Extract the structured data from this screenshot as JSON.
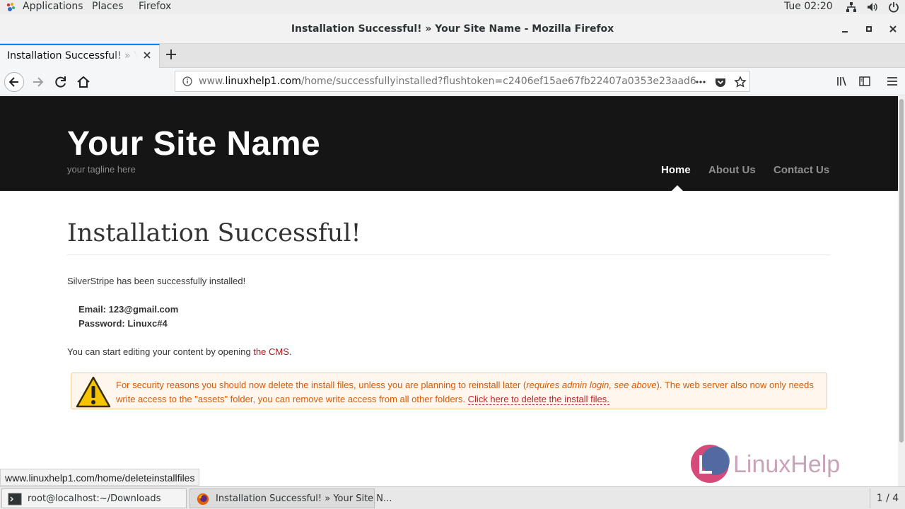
{
  "topbar": {
    "applications": "Applications",
    "places": "Places",
    "firefox": "Firefox",
    "clock": "Tue 02:20"
  },
  "window": {
    "title": "Installation Successful! » Your Site Name - Mozilla Firefox"
  },
  "tab": {
    "label": "Installation Successful! » Your Site Name"
  },
  "url": {
    "prefix": "www.",
    "host": "linuxhelp1.com",
    "path": "/home/successfullyinstalled?flushtoken=c2406ef15ae67fb22407a0353e23aad6"
  },
  "site": {
    "name": "Your Site Name",
    "tagline": "your tagline here",
    "nav": [
      "Home",
      "About Us",
      "Contact Us"
    ]
  },
  "content": {
    "heading": "Installation Successful!",
    "intro": "SilverStripe has been successfully installed!",
    "email": "Email: 123@gmail.com",
    "password": "Password: Linuxc#4",
    "edit_prefix": "You can start editing your content by opening ",
    "edit_link": "the CMS",
    "edit_suffix": "."
  },
  "warning": {
    "text_1": "For security reasons you should now delete the install files, unless you are planning to reinstall later (",
    "text_em": "requires admin login, see above",
    "text_2": "). The web server also now only needs write access to the \"assets\" folder, you can remove write access from all other folders. ",
    "link": "Click here to delete the install files."
  },
  "status_link": "www.linuxhelp1.com/home/deleteinstallfiles",
  "taskbar": {
    "terminal": "root@localhost:~/Downloads",
    "firefox": "Installation Successful! » Your Site N...",
    "workspace": "1 / 4"
  },
  "brand": {
    "watermark": "LinuxHelp"
  },
  "colors": {
    "header_bg": "#151515",
    "link": "#b3131a",
    "warning_text": "#d35b06",
    "warning_bg": "#fff7ee",
    "tab_accent": "#0a84ff"
  }
}
